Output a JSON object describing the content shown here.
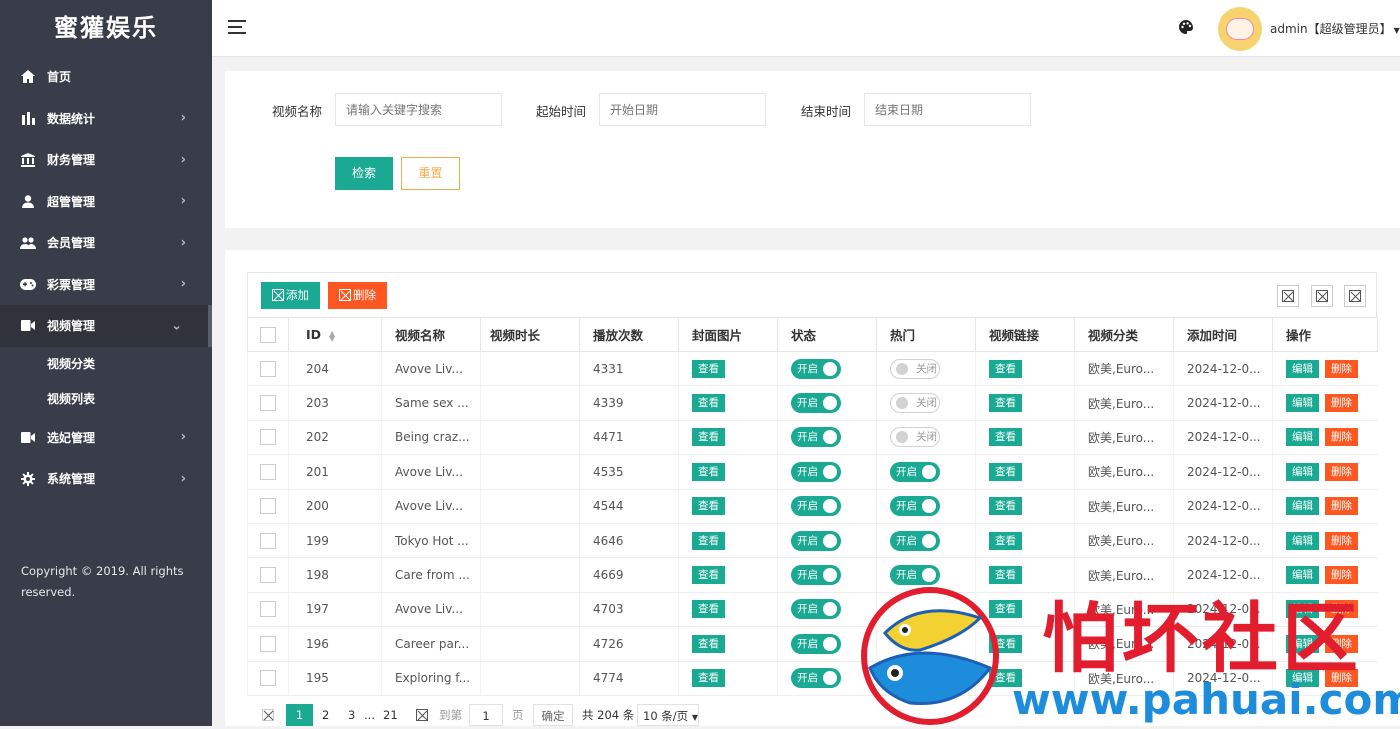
{
  "app": {
    "title": "蜜獾娱乐"
  },
  "sidebar": {
    "items": [
      {
        "label": "首页",
        "icon": "home-icon",
        "has_arrow": false
      },
      {
        "label": "数据统计",
        "icon": "bar-chart-icon",
        "has_arrow": true
      },
      {
        "label": "财务管理",
        "icon": "bank-icon",
        "has_arrow": true
      },
      {
        "label": "超管管理",
        "icon": "user-icon",
        "has_arrow": true
      },
      {
        "label": "会员管理",
        "icon": "users-icon",
        "has_arrow": true
      },
      {
        "label": "彩票管理",
        "icon": "gamepad-icon",
        "has_arrow": true
      },
      {
        "label": "视频管理",
        "icon": "video-icon",
        "has_arrow": true,
        "expanded": true
      }
    ],
    "submenu": [
      {
        "label": "视频分类"
      },
      {
        "label": "视频列表"
      }
    ],
    "items_after": [
      {
        "label": "选妃管理",
        "icon": "video-icon",
        "has_arrow": true
      },
      {
        "label": "系统管理",
        "icon": "gear-icon",
        "has_arrow": true
      }
    ],
    "copyright": "Copyright © 2019. All rights reserved."
  },
  "header": {
    "user_name": "admin【超级管理员】",
    "theme_icon": "palette-icon"
  },
  "search": {
    "name_label": "视频名称",
    "name_placeholder": "请输入关键字搜索",
    "start_label": "起始时间",
    "start_placeholder": "开始日期",
    "end_label": "结束时间",
    "end_placeholder": "结束日期",
    "search_button": "检索",
    "reset_button": "重置"
  },
  "toolbar": {
    "add_label": "添加",
    "delete_label": "删除"
  },
  "table": {
    "columns": [
      "ID",
      "视频名称",
      "视频时长",
      "播放次数",
      "封面图片",
      "状态",
      "热门",
      "视频链接",
      "视频分类",
      "添加时间",
      "操作"
    ],
    "view_label": "查看",
    "edit_label": "编辑",
    "remove_label": "删除",
    "on_label": "开启",
    "off_label": "关闭",
    "rows": [
      {
        "id": "204",
        "name": "Avove Liv...",
        "duration": "",
        "plays": "4331",
        "status": "开启",
        "hot": "关闭",
        "category": "欧美,Euro...",
        "added": "2024-12-0..."
      },
      {
        "id": "203",
        "name": "Same sex ...",
        "duration": "",
        "plays": "4339",
        "status": "开启",
        "hot": "关闭",
        "category": "欧美,Euro...",
        "added": "2024-12-0..."
      },
      {
        "id": "202",
        "name": "Being craz...",
        "duration": "",
        "plays": "4471",
        "status": "开启",
        "hot": "关闭",
        "category": "欧美,Euro...",
        "added": "2024-12-0..."
      },
      {
        "id": "201",
        "name": "Avove Liv...",
        "duration": "",
        "plays": "4535",
        "status": "开启",
        "hot": "开启",
        "category": "欧美,Euro...",
        "added": "2024-12-0..."
      },
      {
        "id": "200",
        "name": "Avove Liv...",
        "duration": "",
        "plays": "4544",
        "status": "开启",
        "hot": "开启",
        "category": "欧美,Euro...",
        "added": "2024-12-0..."
      },
      {
        "id": "199",
        "name": "Tokyo Hot ...",
        "duration": "",
        "plays": "4646",
        "status": "开启",
        "hot": "开启",
        "category": "欧美,Euro...",
        "added": "2024-12-0..."
      },
      {
        "id": "198",
        "name": "Care from ...",
        "duration": "",
        "plays": "4669",
        "status": "开启",
        "hot": "开启",
        "category": "欧美,Euro...",
        "added": "2024-12-0..."
      },
      {
        "id": "197",
        "name": "Avove Liv...",
        "duration": "",
        "plays": "4703",
        "status": "开启",
        "hot": "",
        "category": "欧美,Euro...",
        "added": "2024-12-0..."
      },
      {
        "id": "196",
        "name": "Career par...",
        "duration": "",
        "plays": "4726",
        "status": "开启",
        "hot": "",
        "category": "欧美,Euro...",
        "added": "2024-12-0..."
      },
      {
        "id": "195",
        "name": "Exploring f...",
        "duration": "",
        "plays": "4774",
        "status": "开启",
        "hot": "",
        "category": "欧美,Euro...",
        "added": "2024-12-0..."
      }
    ]
  },
  "pager": {
    "pages": [
      "1",
      "2",
      "3",
      "...",
      "21"
    ],
    "goto_label": "到第",
    "goto_value": "1",
    "page_unit": "页",
    "confirm_label": "确定",
    "total": "共 204 条",
    "per_page": "10 条/页"
  },
  "watermark": {
    "text": "怕坏社区",
    "url": "www.pahuai.com"
  }
}
